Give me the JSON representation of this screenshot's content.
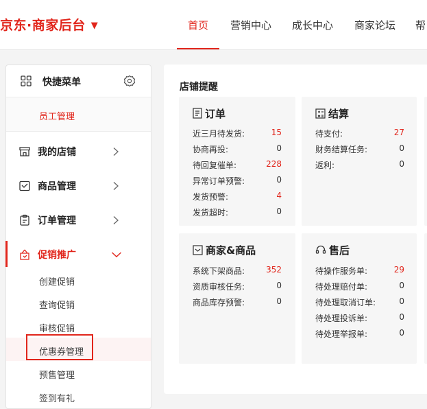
{
  "brand": {
    "title": "京东·商家后台",
    "caret": "▼"
  },
  "nav": {
    "items": [
      {
        "label": "首页",
        "active": true
      },
      {
        "label": "营销中心"
      },
      {
        "label": "成长中心"
      },
      {
        "label": "商家论坛"
      },
      {
        "label": "帮"
      }
    ]
  },
  "sidebar": {
    "quick_title": "快捷菜单",
    "quick_items": [
      "员工管理"
    ],
    "menus": [
      {
        "label": "我的店铺",
        "icon": "store-icon"
      },
      {
        "label": "商品管理",
        "icon": "product-icon"
      },
      {
        "label": "订单管理",
        "icon": "order-icon"
      },
      {
        "label": "促销推广",
        "icon": "promotion-icon",
        "active": true
      }
    ],
    "sub_items": [
      "创建促销",
      "查询促销",
      "审核促销",
      "优惠券管理",
      "预售管理",
      "签到有礼"
    ]
  },
  "main": {
    "title": "店铺提醒",
    "cards": {
      "order": {
        "title": "订单",
        "rows": [
          {
            "label": "近三月待发货:",
            "value": "15",
            "highlight": true
          },
          {
            "label": "协商再投:",
            "value": "0"
          },
          {
            "label": "待回复催单:",
            "value": "228",
            "highlight": true
          },
          {
            "label": "异常订单预警:",
            "value": "0"
          },
          {
            "label": "发货预警:",
            "value": "4",
            "highlight": true
          },
          {
            "label": "发货超时:",
            "value": "0"
          }
        ]
      },
      "settlement": {
        "title": "结算",
        "rows": [
          {
            "label": "待支付:",
            "value": "27",
            "highlight": true
          },
          {
            "label": "财务结算任务:",
            "value": "0"
          },
          {
            "label": "返利:",
            "value": "0"
          }
        ]
      },
      "merchant": {
        "title": "商家&商品",
        "rows": [
          {
            "label": "系统下架商品:",
            "value": "352",
            "highlight": true
          },
          {
            "label": "资质审核任务:",
            "value": "0"
          },
          {
            "label": "商品库存预警:",
            "value": "0"
          }
        ]
      },
      "aftersale": {
        "title": "售后",
        "rows": [
          {
            "label": "待操作服务单:",
            "value": "29",
            "highlight": true
          },
          {
            "label": "待处理赔付单:",
            "value": "0"
          },
          {
            "label": "待处理取消订单:",
            "value": "0"
          },
          {
            "label": "待处理投诉单:",
            "value": "0"
          },
          {
            "label": "待处理举报单:",
            "value": "0"
          }
        ]
      }
    }
  },
  "colors": {
    "accent": "#e1251b",
    "panel": "#f6f6f6"
  }
}
